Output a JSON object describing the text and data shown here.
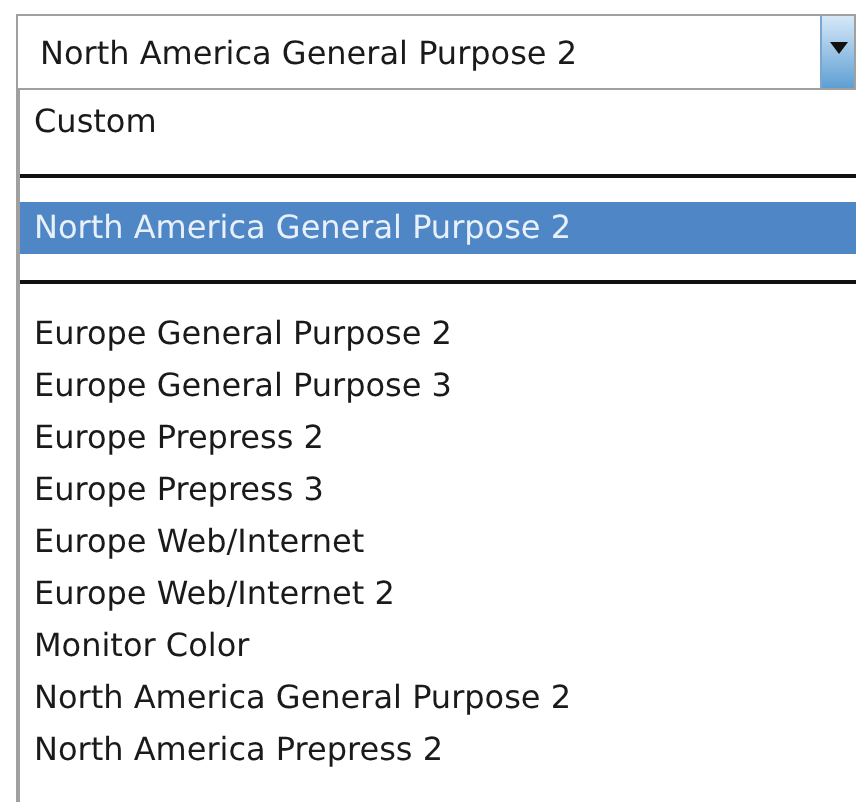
{
  "combo_box": {
    "value": "North America General Purpose 2"
  },
  "list": [
    {
      "kind": "option",
      "label": "Custom",
      "selected": false
    },
    {
      "kind": "separator"
    },
    {
      "kind": "option",
      "label": "North America General Purpose 2",
      "selected": true
    },
    {
      "kind": "separator"
    },
    {
      "kind": "option",
      "label": "Europe General Purpose 2",
      "selected": false
    },
    {
      "kind": "option",
      "label": "Europe General Purpose 3",
      "selected": false
    },
    {
      "kind": "option",
      "label": "Europe Prepress 2",
      "selected": false
    },
    {
      "kind": "option",
      "label": "Europe Prepress 3",
      "selected": false
    },
    {
      "kind": "option",
      "label": "Europe Web/Internet",
      "selected": false
    },
    {
      "kind": "option",
      "label": "Europe Web/Internet 2",
      "selected": false
    },
    {
      "kind": "option",
      "label": "Monitor Color",
      "selected": false
    },
    {
      "kind": "option",
      "label": "North America General Purpose 2",
      "selected": false
    },
    {
      "kind": "option",
      "label": "North America Prepress 2",
      "selected": false
    }
  ]
}
